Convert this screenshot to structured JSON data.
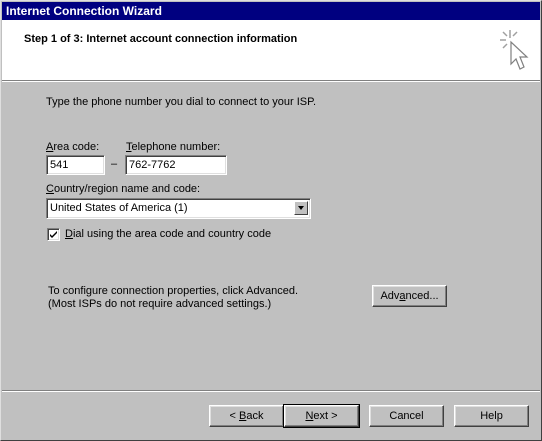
{
  "window": {
    "title": "Internet Connection Wizard"
  },
  "header": {
    "title": "Step 1 of 3: Internet account connection information"
  },
  "body": {
    "instruction": "Type the phone number you dial to connect to your ISP.",
    "area_code": {
      "label_mnemonic": "A",
      "label_rest": "rea code:",
      "value": "541"
    },
    "dash": "–",
    "telephone": {
      "label_mnemonic": "T",
      "label_rest": "elephone number:",
      "value": "762-7762"
    },
    "country": {
      "label_mnemonic": "C",
      "label_rest": "ountry/region name and code:",
      "selected": "United States of America (1)"
    },
    "dial_checkbox": {
      "checked": true,
      "label_mnemonic": "D",
      "label_rest": "ial using the area code and country code"
    },
    "advanced_note_line1": "To configure connection properties, click Advanced.",
    "advanced_note_line2": "(Most ISPs do not require advanced settings.)",
    "advanced_button": {
      "label_pre": "Adv",
      "label_mnemonic": "a",
      "label_post": "nced..."
    }
  },
  "footer": {
    "back": {
      "prefix": "< ",
      "mnemonic": "B",
      "rest": "ack"
    },
    "next": {
      "mnemonic": "N",
      "rest": "ext >"
    },
    "cancel": "Cancel",
    "help": "Help"
  },
  "icons": {
    "header": "wizard-cursor-icon",
    "checkmark": "checkmark-icon",
    "dropdown": "chevron-down-icon"
  }
}
